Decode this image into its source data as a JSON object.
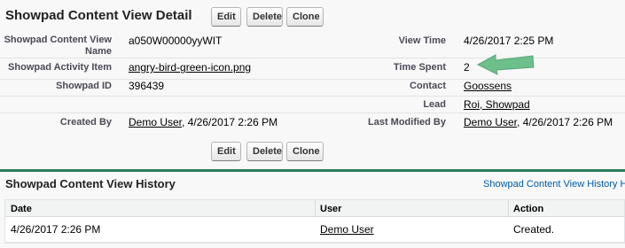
{
  "detail": {
    "title": "Showpad Content View Detail",
    "buttons": {
      "edit": "Edit",
      "delete": "Delete",
      "clone": "Clone"
    },
    "fields": {
      "content_view_name_label": "Showpad Content View Name",
      "content_view_name_value": "a050W00000yyWIT",
      "view_time_label": "View Time",
      "view_time_value": "4/26/2017 2:25 PM",
      "activity_item_label": "Showpad Activity Item",
      "activity_item_value": "angry-bird-green-icon.png",
      "time_spent_label": "Time Spent",
      "time_spent_value": "2",
      "showpad_id_label": "Showpad ID",
      "showpad_id_value": "396439",
      "contact_label": "Contact",
      "contact_value": "Goossens",
      "lead_label": "Lead",
      "lead_value": "Roi, Showpad",
      "created_by_label": "Created By",
      "created_by_user": "Demo User",
      "created_by_date": ", 4/26/2017 2:26 PM",
      "last_modified_label": "Last Modified By",
      "last_modified_user": "Demo User",
      "last_modified_date": ", 4/26/2017 2:26 PM"
    },
    "arrow_color": "#6dbf8b"
  },
  "history": {
    "title": "Showpad Content View History",
    "help_link": "Showpad Content View History H",
    "columns": [
      "Date",
      "User",
      "Action"
    ],
    "rows": [
      {
        "date": "4/26/2017 2:26 PM",
        "user": "Demo User",
        "action": "Created."
      }
    ]
  },
  "colors": {
    "divider": "#2e7d5b",
    "link": "#015ba7"
  }
}
